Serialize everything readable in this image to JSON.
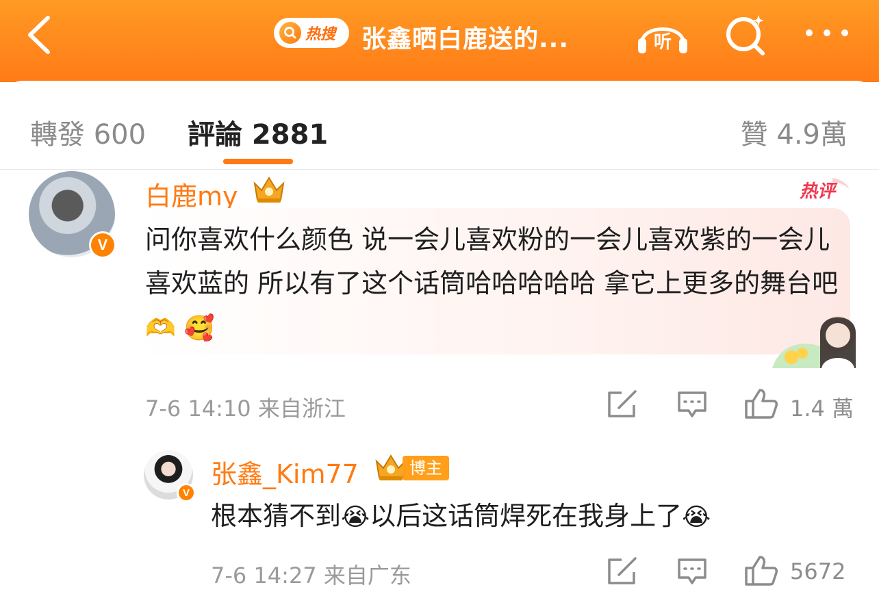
{
  "header": {
    "hot_search_label": "热搜",
    "title": "张鑫晒白鹿送的...",
    "listen_label": "听"
  },
  "tabs": {
    "repost": "轉發 600",
    "comment": "評論 2881",
    "like": "贊 4.9萬"
  },
  "comments": [
    {
      "username": "白鹿my",
      "hot_tag": "热评",
      "text": "问你喜欢什么颜色 说一会儿喜欢粉的一会儿喜欢紫的一会儿喜欢蓝的 所以有了这个话筒哈哈哈哈哈 拿它上更多的舞台吧",
      "emojis": [
        "🫶",
        "🥰"
      ],
      "meta": "7-6 14:10  来自浙江",
      "likes": "1.4 萬"
    },
    {
      "username": "张鑫_Kim77",
      "owner_tag": "博主",
      "text_part1": "根本猜不到",
      "text_part2": "以后这话筒焊死在我身上了",
      "emojis": [
        "😭",
        "😭"
      ],
      "meta": "7-6 14:27  来自广东",
      "likes": "5672"
    }
  ],
  "badge": {
    "verified": "V"
  },
  "colors": {
    "accent": "#ff7a12",
    "header": "#ff8a1f"
  }
}
